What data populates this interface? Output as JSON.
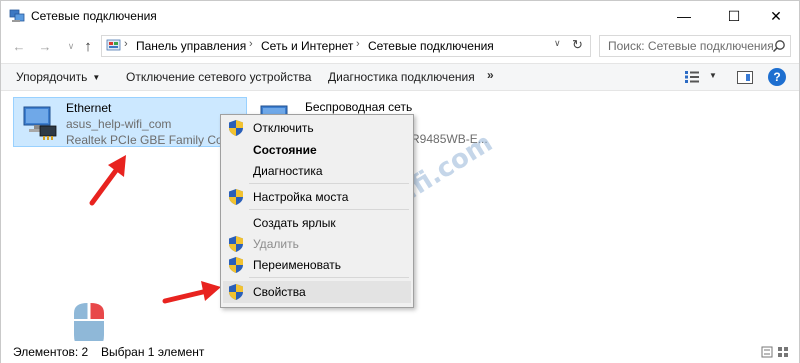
{
  "window": {
    "title": "Сетевые подключения",
    "controls": {
      "minimize": "—",
      "maximize": "☐",
      "close": "✕"
    }
  },
  "nav": {
    "back": "←",
    "forward": "→",
    "recent": "∨",
    "up": "↑",
    "breadcrumbs": [
      "Панель управления",
      "Сеть и Интернет",
      "Сетевые подключения"
    ],
    "separator": "›",
    "refresh": "↻",
    "dropdown": "∨",
    "search_placeholder": "Поиск: Сетевые подключения"
  },
  "commandbar": {
    "organize": "Упорядочить",
    "disable": "Отключение сетевого устройства",
    "diagnose": "Диагностика подключения",
    "more": "»",
    "help": "?"
  },
  "items": [
    {
      "name": "Ethernet",
      "network": "asus_help-wifi_com",
      "adapter": "Realtek PCIe GBE Family Contr"
    },
    {
      "name": "Беспроводная сеть",
      "adapter_fragment": "R9485WB-E..."
    }
  ],
  "context_menu": {
    "items": [
      {
        "label": "Отключить",
        "shield": true,
        "bold": false,
        "disabled": false
      },
      {
        "label": "Состояние",
        "shield": false,
        "bold": true,
        "disabled": false
      },
      {
        "label": "Диагностика",
        "shield": false,
        "bold": false,
        "disabled": false
      },
      {
        "label": "Настройка моста",
        "shield": true,
        "bold": false,
        "disabled": false
      },
      {
        "label": "Создать ярлык",
        "shield": false,
        "bold": false,
        "disabled": false
      },
      {
        "label": "Удалить",
        "shield": true,
        "bold": false,
        "disabled": true
      },
      {
        "label": "Переименовать",
        "shield": true,
        "bold": false,
        "disabled": false
      },
      {
        "label": "Свойства",
        "shield": true,
        "bold": false,
        "disabled": false,
        "highlighted": true
      }
    ]
  },
  "watermark": "help-wifi.com",
  "statusbar": {
    "count": "Элементов: 2",
    "selected": "Выбран 1 элемент"
  },
  "colors": {
    "selection_bg": "#cce8ff",
    "selection_border": "#99d1ff",
    "annotation_red": "#e8231f",
    "help_blue": "#1e6fd0"
  }
}
